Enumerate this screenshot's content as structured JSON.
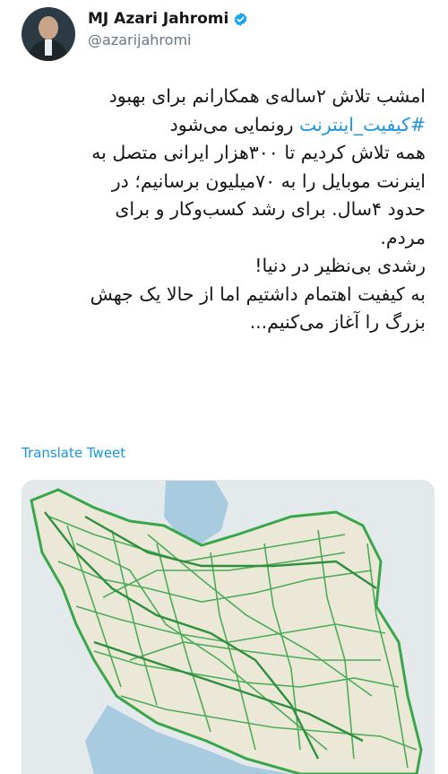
{
  "user": {
    "name": "MJ Azari Jahromi",
    "handle": "@azarijahromi"
  },
  "tweet": {
    "line1": "امشب تلاش ۲ساله‌ی همکارانم برای بهبود",
    "hashtag": "#کیفیت_اینترنت",
    "line2_rest": " رونمایی می‌شود",
    "line3": "همه تلاش کردیم تا ۳۰۰هزار ایرانی متصل به",
    "line4": "اینرنت موبایل را به ۷۰میلیون برسانیم؛ در",
    "line5": "حدود ۴سال. برای رشد کسب‌وکار و برای",
    "line6": "مردم.",
    "line7": "رشدی بی‌نظیر در دنیا!",
    "line8": "به کیفیت اهتمام داشتیم اما از حالا یک جهش",
    "line9": "بزرگ را آغاز می‌کنیم..."
  },
  "translate_label": "Translate Tweet",
  "colors": {
    "accent": "#1b95e0",
    "verified": "#1da1f2",
    "map_land": "#ece8d8",
    "map_sea": "#a8cbe0",
    "map_network": "#3aa64a"
  },
  "icons": {
    "verified": "verified-badge-icon"
  }
}
